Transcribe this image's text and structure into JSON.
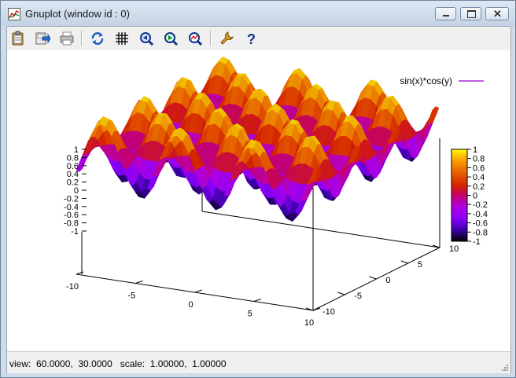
{
  "window": {
    "title": "Gnuplot (window id : 0)"
  },
  "toolbar": {
    "buttons": [
      {
        "name": "copy-to-clipboard",
        "icon": "clipboard-icon"
      },
      {
        "name": "save",
        "icon": "save-icon"
      },
      {
        "name": "print",
        "icon": "printer-icon"
      },
      {
        "name": "replot",
        "icon": "refresh-icon"
      },
      {
        "name": "grid",
        "icon": "grid-icon"
      },
      {
        "name": "zoom-previous",
        "icon": "zoom-previous-icon"
      },
      {
        "name": "zoom-next",
        "icon": "zoom-next-icon"
      },
      {
        "name": "autoscale",
        "icon": "autoscale-icon"
      },
      {
        "name": "options",
        "icon": "wrench-icon"
      },
      {
        "name": "help",
        "icon": "help-icon"
      }
    ]
  },
  "status": {
    "text": "view:  60.0000,  30.0000   scale:  1.00000,  1.00000"
  },
  "chart_data": {
    "type": "surface",
    "function": "sin(x)*cos(y)",
    "legend": {
      "label": "sin(x)*cos(y)",
      "position": "top-right",
      "color": "#9400d3"
    },
    "xrange": [
      -10,
      10
    ],
    "yrange": [
      -10,
      10
    ],
    "zrange": [
      -1,
      1
    ],
    "view": {
      "rot_x": 60,
      "rot_z": 30
    },
    "x_ticks": [
      "-10",
      "-5",
      "0",
      "5",
      "10"
    ],
    "y_ticks": [
      "-10",
      "-5",
      "0",
      "5",
      "10"
    ],
    "z_ticks": [
      "1",
      "0.8",
      "0.6",
      "0.4",
      "0.2",
      "0",
      "-0.2",
      "-0.4",
      "-0.6",
      "-0.8",
      "-1"
    ],
    "colorbox_ticks": [
      "1",
      "0.8",
      "0.6",
      "0.4",
      "0.2",
      "0",
      "-0.2",
      "-0.4",
      "-0.6",
      "-0.8",
      "-1"
    ],
    "palette": [
      "#000000",
      "#3d00a8",
      "#8a00ff",
      "#b000e0",
      "#c4006a",
      "#d22000",
      "#e65400",
      "#f59000",
      "#ffd000",
      "#ffff00"
    ]
  }
}
